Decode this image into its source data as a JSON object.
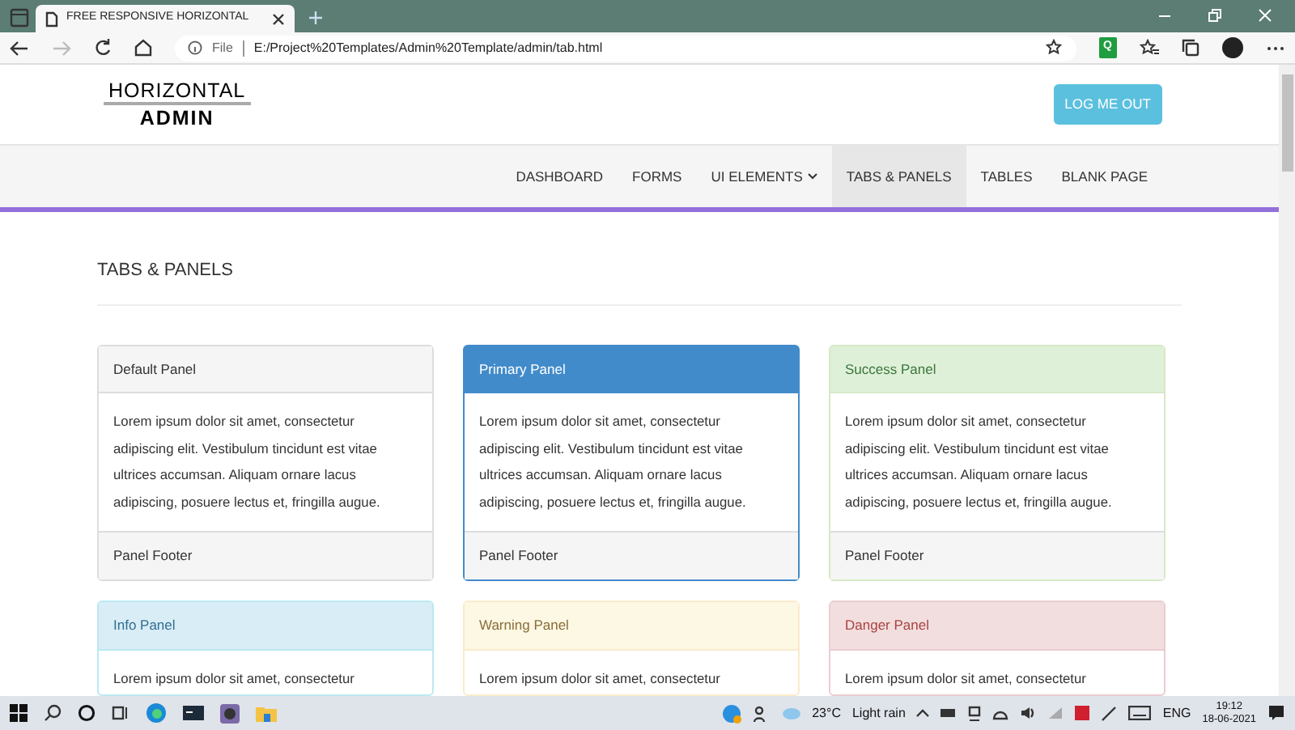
{
  "browser": {
    "tab_title": "FREE RESPONSIVE HORIZONTAL",
    "address_label": "File",
    "url": "E:/Project%20Templates/Admin%20Template/admin/tab.html",
    "extension_label": "Q"
  },
  "header": {
    "logo_top": "HORIZONTAL",
    "logo_bottom": "ADMIN",
    "logout_button": "LOG ME OUT"
  },
  "nav": [
    {
      "label": "DASHBOARD",
      "selected": false,
      "dropdown": false
    },
    {
      "label": "FORMS",
      "selected": false,
      "dropdown": false
    },
    {
      "label": "UI ELEMENTS",
      "selected": false,
      "dropdown": true
    },
    {
      "label": "TABS & PANELS",
      "selected": true,
      "dropdown": false
    },
    {
      "label": "TABLES",
      "selected": false,
      "dropdown": false
    },
    {
      "label": "BLANK PAGE",
      "selected": false,
      "dropdown": false
    }
  ],
  "page_title": "TABS & PANELS",
  "panels": [
    {
      "kind": "default",
      "heading": "Default Panel",
      "body": "Lorem ipsum dolor sit amet, consectetur adipiscing elit. Vestibulum tincidunt est vitae ultrices accumsan. Aliquam ornare lacus adipiscing, posuere lectus et, fringilla augue.",
      "footer": "Panel Footer"
    },
    {
      "kind": "primary",
      "heading": "Primary Panel",
      "body": "Lorem ipsum dolor sit amet, consectetur adipiscing elit. Vestibulum tincidunt est vitae ultrices accumsan. Aliquam ornare lacus adipiscing, posuere lectus et, fringilla augue.",
      "footer": "Panel Footer"
    },
    {
      "kind": "success",
      "heading": "Success Panel",
      "body": "Lorem ipsum dolor sit amet, consectetur adipiscing elit. Vestibulum tincidunt est vitae ultrices accumsan. Aliquam ornare lacus adipiscing, posuere lectus et, fringilla augue.",
      "footer": "Panel Footer"
    },
    {
      "kind": "info",
      "heading": "Info Panel",
      "body": "Lorem ipsum dolor sit amet, consectetur"
    },
    {
      "kind": "warning",
      "heading": "Warning Panel",
      "body": "Lorem ipsum dolor sit amet, consectetur"
    },
    {
      "kind": "danger",
      "heading": "Danger Panel",
      "body": "Lorem ipsum dolor sit amet, consectetur"
    }
  ],
  "taskbar": {
    "temperature": "23°C",
    "weather": "Light rain",
    "language": "ENG",
    "time": "19:12",
    "date": "18-06-2021"
  }
}
